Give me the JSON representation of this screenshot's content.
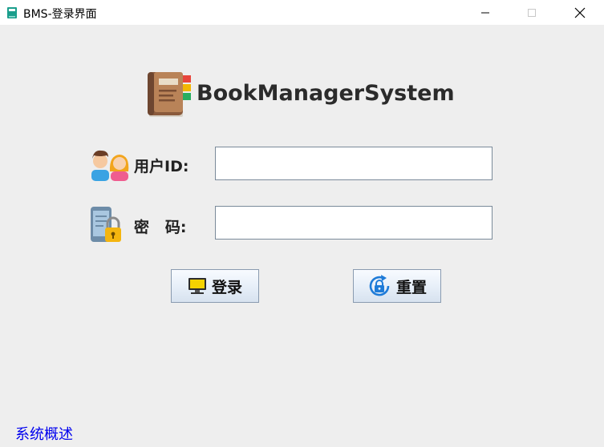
{
  "window": {
    "title": "BMS-登录界面",
    "minimize_label": "",
    "maximize_label": "",
    "close_label": ""
  },
  "header": {
    "app_name": "BookManagerSystem",
    "logo_icon": "book-logo-icon"
  },
  "form": {
    "user_label": "用户ID:",
    "user_value": "",
    "user_icon": "users-icon",
    "password_label": "密   码:",
    "password_value": "",
    "password_icon": "phone-lock-icon"
  },
  "buttons": {
    "login_label": "登录",
    "login_icon": "monitor-icon",
    "reset_label": "重置",
    "reset_icon": "refresh-lock-icon"
  },
  "footer": {
    "about_link": "系统概述"
  },
  "colors": {
    "background": "#eeeeee",
    "link": "#0000ee",
    "button_border": "#8a9bb0",
    "field_border": "#7a8a9a"
  }
}
